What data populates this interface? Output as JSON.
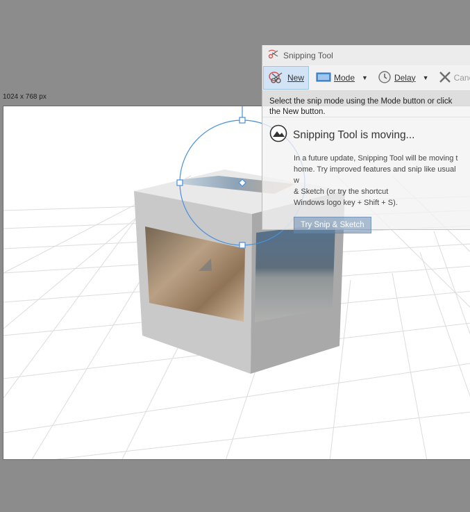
{
  "canvas": {
    "dimensions_label": "1024 x 768 px"
  },
  "snipping_tool": {
    "title": "Snipping Tool",
    "toolbar": {
      "new_label": "New",
      "mode_label": "Mode",
      "delay_label": "Delay",
      "cancel_label": "Cance"
    },
    "hint": "Select the snip mode using the Mode button or click the New button.",
    "notice": {
      "title": "Snipping Tool is moving...",
      "line1": "In a future update, Snipping Tool will be moving t",
      "line2": "home. Try improved features and snip like usual w",
      "line3": "& Sketch (or try the shortcut",
      "line4": "Windows logo key + Shift + S).",
      "button": "Try Snip & Sketch"
    }
  },
  "colors": {
    "background": "#8c8c8c",
    "selection": "#4a90d9",
    "accent_button": "#698db2"
  },
  "icons": [
    "scissors-icon",
    "mode-icon",
    "clock-icon",
    "close-x-icon",
    "caret-down-icon",
    "snip-sketch-icon"
  ]
}
